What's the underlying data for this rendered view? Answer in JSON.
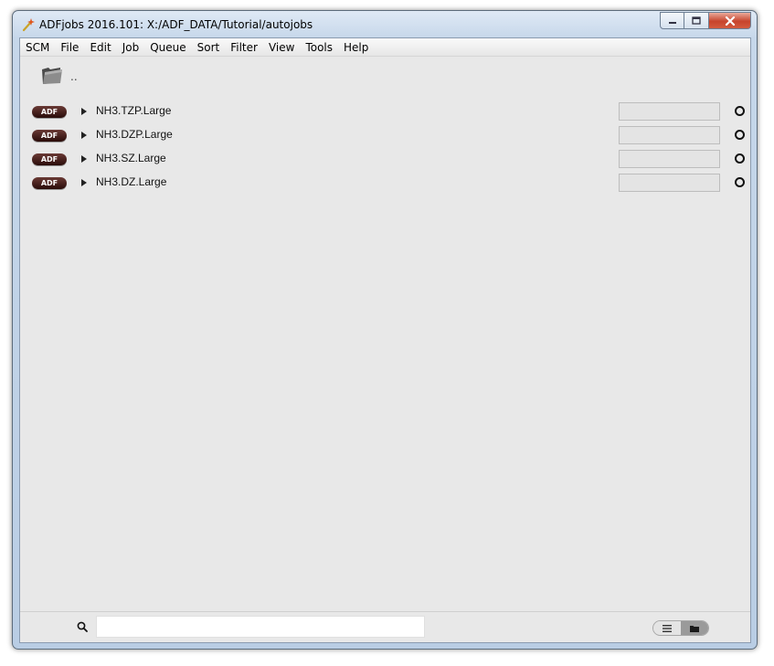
{
  "window": {
    "title": "ADFjobs 2016.101: X:/ADF_DATA/Tutorial/autojobs"
  },
  "menu": [
    "SCM",
    "File",
    "Edit",
    "Job",
    "Queue",
    "Sort",
    "Filter",
    "View",
    "Tools",
    "Help"
  ],
  "parent": {
    "label": ".."
  },
  "jobs": [
    {
      "badge": "ADF",
      "name": "NH3.TZP.Large"
    },
    {
      "badge": "ADF",
      "name": "NH3.DZP.Large"
    },
    {
      "badge": "ADF",
      "name": "NH3.SZ.Large"
    },
    {
      "badge": "ADF",
      "name": "NH3.DZ.Large"
    }
  ],
  "search": {
    "value": "",
    "placeholder": ""
  },
  "icons": {
    "app": "wand-icon",
    "parent": "folder-icon",
    "expander": "triangle-right-icon",
    "status": "ring-icon",
    "search": "magnifier-icon",
    "list_view": "list-icon",
    "folder_view": "folder-icon"
  },
  "colors": {
    "badge": "#3a1412",
    "window_frame": "#b9cde4",
    "client": "#e8e8e8"
  }
}
